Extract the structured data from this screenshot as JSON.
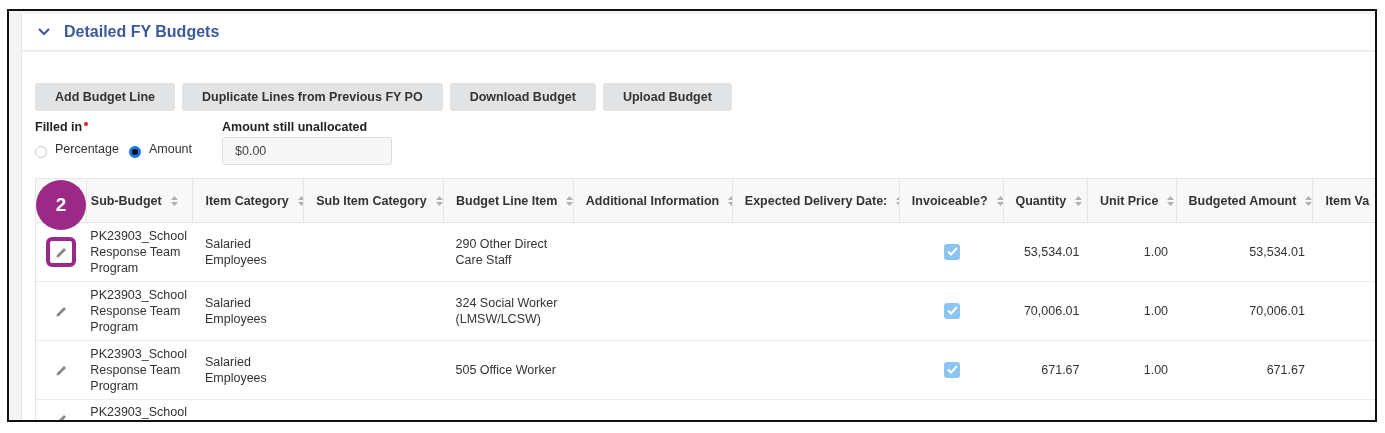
{
  "section": {
    "title": "Detailed FY Budgets",
    "expanded": true
  },
  "buttons": [
    "Add Budget Line",
    "Duplicate Lines from Previous FY PO",
    "Download Budget",
    "Upload Budget"
  ],
  "filled_in": {
    "label": "Filled in",
    "required": true,
    "options": [
      {
        "label": "Percentage",
        "selected": false
      },
      {
        "label": "Amount",
        "selected": true
      }
    ]
  },
  "unallocated": {
    "label": "Amount still unallocated",
    "value": "$0.00"
  },
  "callout": {
    "number": "2"
  },
  "table": {
    "columns": [
      "Sub-Budget",
      "Item Category",
      "Sub Item Category",
      "Budget Line Item",
      "Additional Information",
      "Expected Delivery Date:",
      "Invoiceable?",
      "Quantity",
      "Unit Price",
      "Budgeted Amount",
      "Item Va"
    ],
    "rows": [
      {
        "highlighted": true,
        "sub_budget": "PK23903_School Response Team Program",
        "item_category": "Salaried Employees",
        "budget_line_item": "290 Other Direct Care Staff",
        "invoiceable": true,
        "quantity": "53,534.01",
        "unit_price": "1.00",
        "budgeted_amount": "53,534.01"
      },
      {
        "highlighted": false,
        "sub_budget": "PK23903_School Response Team Program",
        "item_category": "Salaried Employees",
        "budget_line_item": "324 Social Worker (LMSW/LCSW)",
        "invoiceable": true,
        "quantity": "70,006.01",
        "unit_price": "1.00",
        "budgeted_amount": "70,006.01"
      },
      {
        "highlighted": false,
        "sub_budget": "PK23903_School Response Team Program",
        "item_category": "Salaried Employees",
        "budget_line_item": "505 Office Worker",
        "invoiceable": true,
        "quantity": "671.67",
        "unit_price": "1.00",
        "budgeted_amount": "671.67"
      },
      {
        "highlighted": false,
        "sub_budget": "PK23903_School"
      }
    ]
  }
}
